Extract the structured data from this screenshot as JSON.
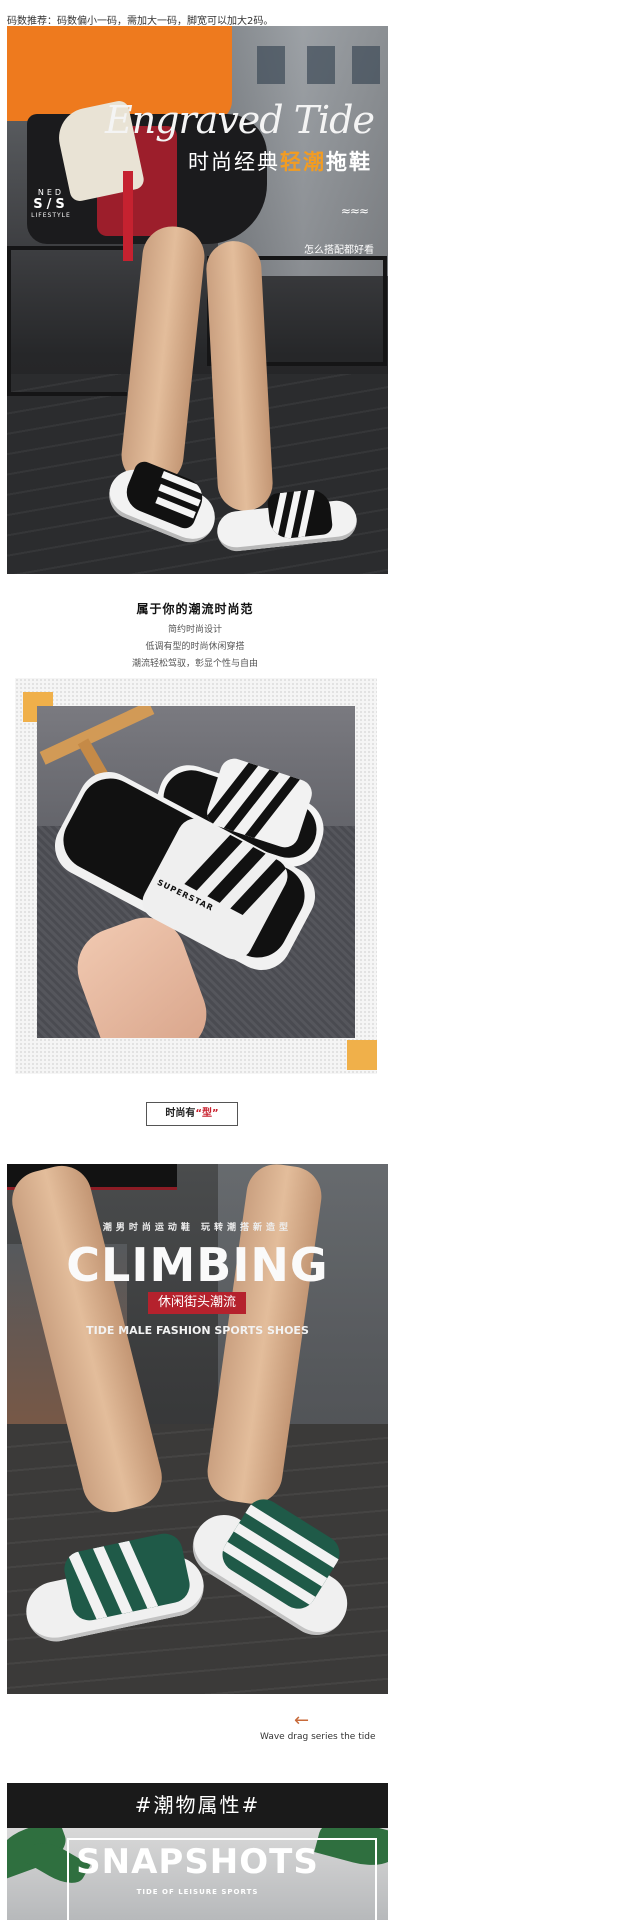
{
  "size_note": "码数推荐：码数偏小一码，需加大一码，脚宽可以加大2码。",
  "hero1": {
    "title": "Engraved Tide",
    "subtitle_a": "时尚经典",
    "subtitle_b": "轻潮",
    "subtitle_c": "拖鞋",
    "brand_top": "NED",
    "brand_mid": "S/S",
    "brand_bottom": "LIFESTYLE",
    "wave": "≈≈≈",
    "tagline": "怎么搭配都好看"
  },
  "section2": {
    "title": "属于你的潮流时尚范",
    "lines": [
      "简约时尚设计",
      "低调有型的时尚休闲穿搭",
      "潮流轻松驾驭，彰显个性与自由"
    ]
  },
  "product_strap_text": "SUPERSTAR",
  "style_tag": {
    "prefix": "时尚有",
    "quote": "“型”"
  },
  "hero3": {
    "tagline": "潮男时尚运动鞋 玩转潮搭新造型",
    "title": "CLIMBING",
    "badge": "休闲街头潮流",
    "subtitle": "TIDE MALE FASHION SPORTS SHOES"
  },
  "arrow_icon": "left-arrow-icon",
  "wave_caption": "Wave drag series the tide",
  "snapshots": {
    "header": "#潮物属性#",
    "title": "SNAPSHOTS",
    "subtitle": "TIDE OF LEISURE SPORTS"
  }
}
